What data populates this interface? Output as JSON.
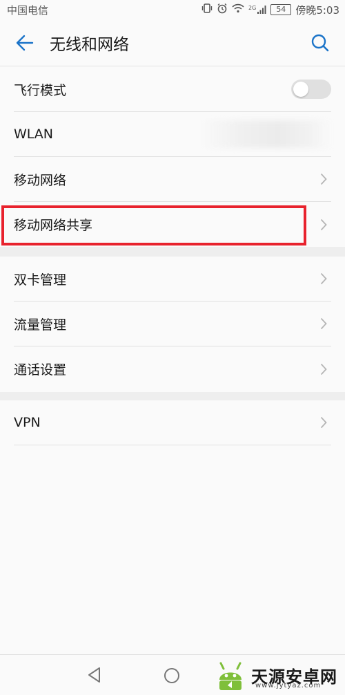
{
  "status_bar": {
    "carrier": "中国电信",
    "network_type": "2G",
    "battery": "54",
    "time": "傍晚5:03"
  },
  "header": {
    "title": "无线和网络"
  },
  "groups": [
    {
      "items": [
        {
          "label": "飞行模式",
          "control": "toggle",
          "state": "off"
        },
        {
          "label": "WLAN",
          "control": "value-blurred"
        },
        {
          "label": "移动网络",
          "control": "chevron"
        },
        {
          "label": "移动网络共享",
          "control": "chevron",
          "highlighted": true
        }
      ]
    },
    {
      "items": [
        {
          "label": "双卡管理",
          "control": "chevron"
        },
        {
          "label": "流量管理",
          "control": "chevron"
        },
        {
          "label": "通话设置",
          "control": "chevron"
        }
      ]
    },
    {
      "items": [
        {
          "label": "VPN",
          "control": "chevron"
        }
      ]
    }
  ],
  "watermark": {
    "text": "天源安卓网",
    "url": "www.jytyaz.com"
  },
  "colors": {
    "accent": "#1a73c8",
    "highlight_border": "#e8222d",
    "chevron": "#b5b5b5",
    "divider": "#e0e0e0",
    "toggle_off": "#e0e0e0"
  }
}
